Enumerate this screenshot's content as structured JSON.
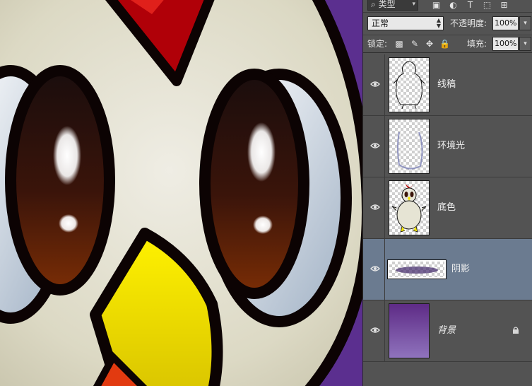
{
  "canvas": {
    "background": "#5b2f8f",
    "cheek_color": "#dcd9c4",
    "comb_color": "#b00008",
    "eye_iris": "#4a1b0b",
    "beak_color": "#f3e400"
  },
  "layers_panel": {
    "filter": {
      "label": "类型",
      "icons": [
        "image-filter-icon",
        "adjustment-filter-icon",
        "text-filter-icon",
        "shape-filter-icon",
        "smartobject-filter-icon"
      ]
    },
    "blend_mode": "正常",
    "opacity_label": "不透明度:",
    "opacity_value": "100%",
    "lock_label": "锁定:",
    "fill_label": "填充:",
    "fill_value": "100%",
    "layers": [
      {
        "name": "线稿",
        "thumb": "lineart",
        "selected": false,
        "visible": true,
        "locked": false
      },
      {
        "name": "环境光",
        "thumb": "ambient",
        "selected": false,
        "visible": true,
        "locked": false
      },
      {
        "name": "底色",
        "thumb": "chicken",
        "selected": false,
        "visible": true,
        "locked": false
      },
      {
        "name": "阴影",
        "thumb": "shadow",
        "selected": true,
        "visible": true,
        "locked": false
      },
      {
        "name": "背景",
        "thumb": "background",
        "selected": false,
        "visible": true,
        "locked": true
      }
    ]
  }
}
